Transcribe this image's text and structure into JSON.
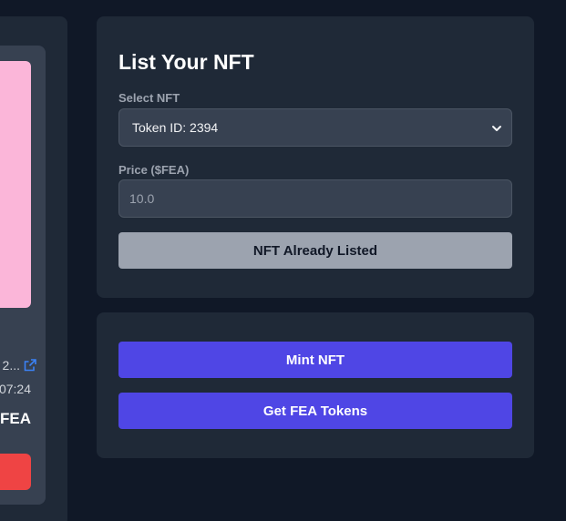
{
  "left_card": {
    "owner_text": "2...",
    "time_text": "07:24",
    "price_text": "$FEA",
    "image_color": "#fbb6d9",
    "action_color": "#ef4444",
    "owner_icon": "external-link-icon"
  },
  "list_panel": {
    "title": "List Your NFT",
    "select_label": "Select NFT",
    "select_value": "Token ID: 2394",
    "price_label": "Price ($FEA)",
    "price_placeholder": "10.0",
    "listed_button": "NFT Already Listed"
  },
  "actions": {
    "mint_button": "Mint NFT",
    "tokens_button": "Get FEA Tokens",
    "accent_color": "#4f46e5"
  }
}
